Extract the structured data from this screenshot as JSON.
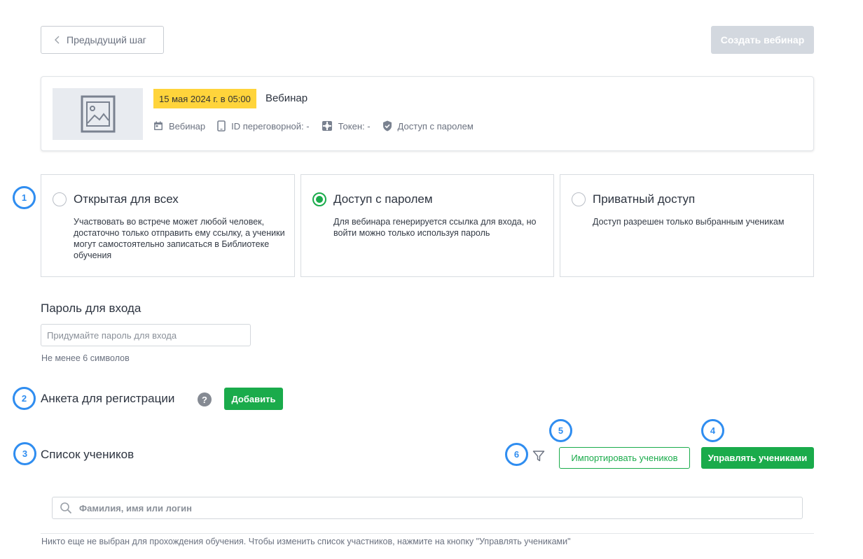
{
  "header": {
    "prev_label": "Предыдущий шаг",
    "create_label": "Создать вебинар"
  },
  "event": {
    "date_badge": "15 мая 2024 г. в 05:00",
    "title": "Вебинар",
    "meta": {
      "type": "Вебинар",
      "room_id": "ID переговорной: -",
      "token": "Токен: -",
      "access": "Доступ с паролем"
    }
  },
  "steps": [
    "1",
    "2",
    "3",
    "4",
    "5",
    "6"
  ],
  "access_options": [
    {
      "title": "Открытая для всех",
      "description": "Участвовать во встрече может любой человек, достаточно только отправить ему ссылку, а ученики могут самостоятельно записаться в Библиотеке обучения",
      "selected": false
    },
    {
      "title": "Доступ с паролем",
      "description": "Для вебинара генерируется ссылка для входа, но войти можно только используя пароль",
      "selected": true
    },
    {
      "title": "Приватный доступ",
      "description": "Доступ разрешен только выбранным ученикам",
      "selected": false
    }
  ],
  "password": {
    "label": "Пароль для входа",
    "placeholder": "Придумайте пароль для входа",
    "value": "",
    "hint": "Не менее 6 символов"
  },
  "registration": {
    "label": "Анкета для регистрации",
    "help_glyph": "?",
    "add_label": "Добавить"
  },
  "students": {
    "label": "Список учеников",
    "import_label": "Импортировать учеников",
    "manage_label": "Управлять учениками",
    "search_placeholder": "Фамилия, имя или логин",
    "empty_note": "Никто еще не выбран для прохождения обучения. Чтобы изменить список участников, нажмите на кнопку \"Управлять учениками\""
  },
  "colors": {
    "accent_green": "#1aab4b",
    "step_blue": "#2f8df0",
    "badge_yellow": "#ffd43b",
    "disabled_button": "#d3d8df"
  },
  "icons": [
    "chevron-left-icon",
    "image-placeholder-icon",
    "calendar-icon",
    "phone-icon",
    "token-icon",
    "shield-check-icon",
    "help-icon",
    "filter-icon",
    "search-icon"
  ]
}
